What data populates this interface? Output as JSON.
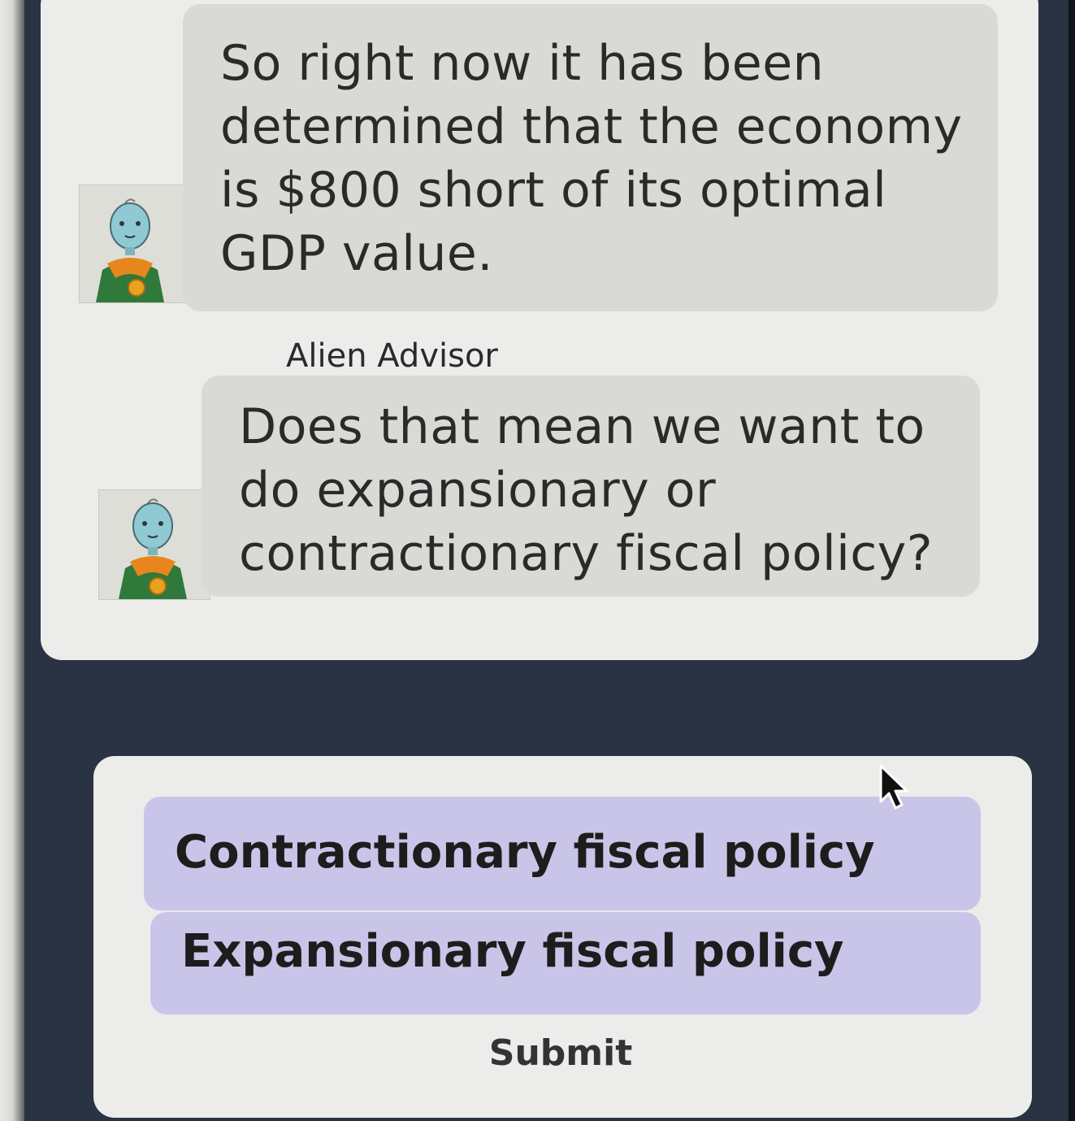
{
  "messages": [
    {
      "sender": "",
      "text": "So right now it has been determined that the economy is $800 short of its optimal GDP value."
    },
    {
      "sender": "Alien Advisor",
      "text": "Does that mean we want to do expansionary or contractionary fiscal policy?"
    }
  ],
  "options": [
    {
      "label": "Contractionary fiscal policy"
    },
    {
      "label": "Expansionary fiscal policy"
    }
  ],
  "submit_label": "Submit",
  "icons": {
    "avatar": "alien-advisor-avatar-icon",
    "cursor": "mouse-pointer-icon"
  },
  "colors": {
    "option_bg": "#c9c5e8",
    "bubble_bg": "#d9d9d5",
    "card_bg": "#ececea",
    "panel_bg": "#2a3344"
  }
}
